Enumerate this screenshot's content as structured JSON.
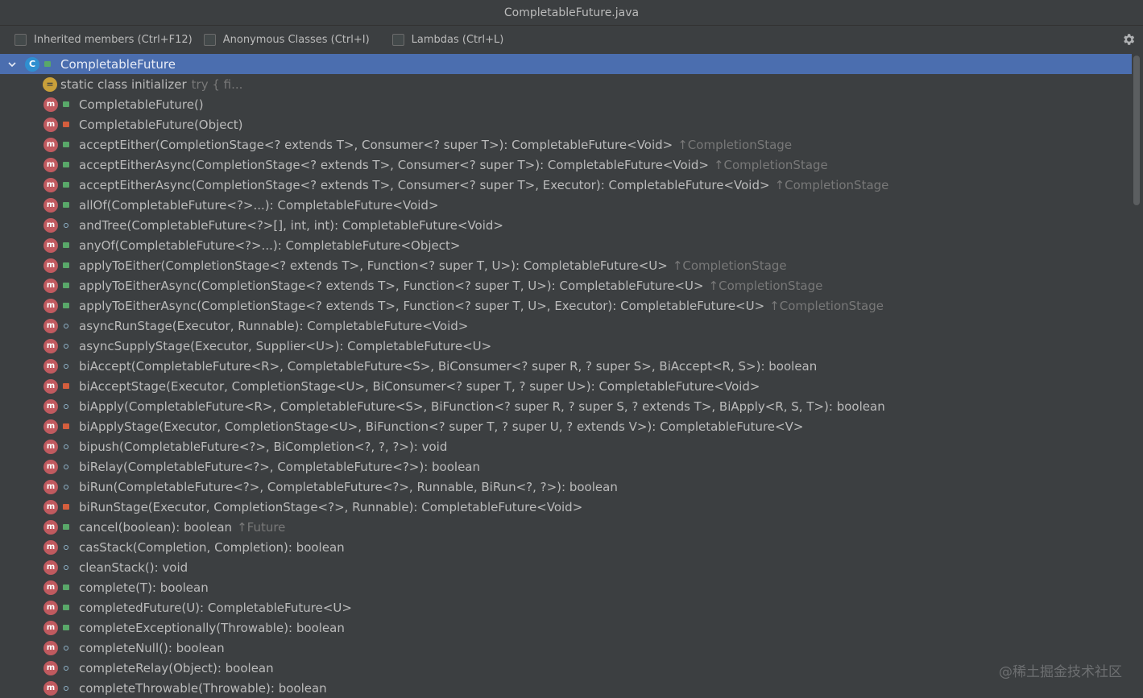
{
  "window": {
    "title": "CompletableFuture.java"
  },
  "toolbar": {
    "inherited_label": "Inherited members (Ctrl+F12)",
    "anonymous_label": "Anonymous Classes (Ctrl+I)",
    "lambdas_label": "Lambdas (Ctrl+L)"
  },
  "tree": {
    "root": {
      "label": "CompletableFuture",
      "icon": "class-icon",
      "icon_glyph": "C"
    },
    "initializer": {
      "label": "static class initializer",
      "hint": "try {            fi..."
    },
    "items": [
      {
        "sig": "CompletableFuture()",
        "vis": "public",
        "inherited": ""
      },
      {
        "sig": "CompletableFuture(Object)",
        "vis": "private",
        "inherited": ""
      },
      {
        "sig": "acceptEither(CompletionStage<? extends T>, Consumer<? super T>): CompletableFuture<Void>",
        "vis": "public",
        "inherited": "↑CompletionStage"
      },
      {
        "sig": "acceptEitherAsync(CompletionStage<? extends T>, Consumer<? super T>): CompletableFuture<Void>",
        "vis": "public",
        "inherited": "↑CompletionStage"
      },
      {
        "sig": "acceptEitherAsync(CompletionStage<? extends T>, Consumer<? super T>, Executor): CompletableFuture<Void>",
        "vis": "public",
        "inherited": "↑CompletionStage"
      },
      {
        "sig": "allOf(CompletableFuture<?>...): CompletableFuture<Void>",
        "vis": "public",
        "inherited": ""
      },
      {
        "sig": "andTree(CompletableFuture<?>[], int, int): CompletableFuture<Void>",
        "vis": "package",
        "inherited": ""
      },
      {
        "sig": "anyOf(CompletableFuture<?>...): CompletableFuture<Object>",
        "vis": "public",
        "inherited": ""
      },
      {
        "sig": "applyToEither(CompletionStage<? extends T>, Function<? super T, U>): CompletableFuture<U>",
        "vis": "public",
        "inherited": "↑CompletionStage"
      },
      {
        "sig": "applyToEitherAsync(CompletionStage<? extends T>, Function<? super T, U>): CompletableFuture<U>",
        "vis": "public",
        "inherited": "↑CompletionStage"
      },
      {
        "sig": "applyToEitherAsync(CompletionStage<? extends T>, Function<? super T, U>, Executor): CompletableFuture<U>",
        "vis": "public",
        "inherited": "↑CompletionStage"
      },
      {
        "sig": "asyncRunStage(Executor, Runnable): CompletableFuture<Void>",
        "vis": "package",
        "inherited": ""
      },
      {
        "sig": "asyncSupplyStage(Executor, Supplier<U>): CompletableFuture<U>",
        "vis": "package",
        "inherited": ""
      },
      {
        "sig": "biAccept(CompletableFuture<R>, CompletableFuture<S>, BiConsumer<? super R, ? super S>, BiAccept<R, S>): boolean",
        "vis": "package",
        "inherited": ""
      },
      {
        "sig": "biAcceptStage(Executor, CompletionStage<U>, BiConsumer<? super T, ? super U>): CompletableFuture<Void>",
        "vis": "private",
        "inherited": ""
      },
      {
        "sig": "biApply(CompletableFuture<R>, CompletableFuture<S>, BiFunction<? super R, ? super S, ? extends T>, BiApply<R, S, T>): boolean",
        "vis": "package",
        "inherited": ""
      },
      {
        "sig": "biApplyStage(Executor, CompletionStage<U>, BiFunction<? super T, ? super U, ? extends V>): CompletableFuture<V>",
        "vis": "private",
        "inherited": ""
      },
      {
        "sig": "bipush(CompletableFuture<?>, BiCompletion<?, ?, ?>): void",
        "vis": "package",
        "inherited": ""
      },
      {
        "sig": "biRelay(CompletableFuture<?>, CompletableFuture<?>): boolean",
        "vis": "package",
        "inherited": ""
      },
      {
        "sig": "biRun(CompletableFuture<?>, CompletableFuture<?>, Runnable, BiRun<?, ?>): boolean",
        "vis": "package",
        "inherited": ""
      },
      {
        "sig": "biRunStage(Executor, CompletionStage<?>, Runnable): CompletableFuture<Void>",
        "vis": "private",
        "inherited": ""
      },
      {
        "sig": "cancel(boolean): boolean",
        "vis": "public",
        "inherited": "↑Future"
      },
      {
        "sig": "casStack(Completion, Completion): boolean",
        "vis": "package",
        "inherited": ""
      },
      {
        "sig": "cleanStack(): void",
        "vis": "package",
        "inherited": ""
      },
      {
        "sig": "complete(T): boolean",
        "vis": "public",
        "inherited": ""
      },
      {
        "sig": "completedFuture(U): CompletableFuture<U>",
        "vis": "public",
        "inherited": ""
      },
      {
        "sig": "completeExceptionally(Throwable): boolean",
        "vis": "public",
        "inherited": ""
      },
      {
        "sig": "completeNull(): boolean",
        "vis": "package",
        "inherited": ""
      },
      {
        "sig": "completeRelay(Object): boolean",
        "vis": "package",
        "inherited": ""
      },
      {
        "sig": "completeThrowable(Throwable): boolean",
        "vis": "package",
        "inherited": ""
      }
    ]
  },
  "watermark": "@稀土掘金技术社区",
  "colors": {
    "selection": "#4b6eaf",
    "background": "#3c3f41",
    "method_icon": "#c05a5f",
    "public": "#59a869",
    "private": "#d45e3d"
  }
}
